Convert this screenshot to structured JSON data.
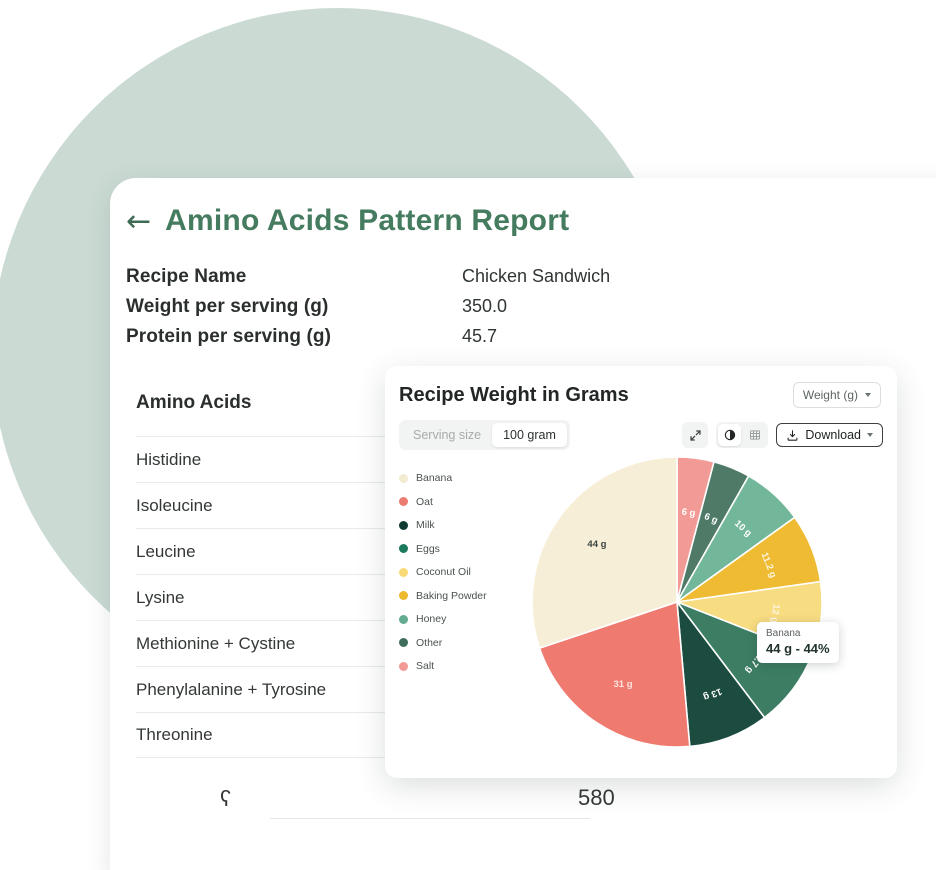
{
  "report": {
    "back_icon": "back-arrow-icon",
    "title": "Amino Acids Pattern Report",
    "meta": [
      {
        "label": "Recipe Name",
        "value": "Chicken Sandwich"
      },
      {
        "label": "Weight per serving (g)",
        "value": "350.0"
      },
      {
        "label": "Protein per serving (g)",
        "value": "45.7"
      }
    ],
    "table_header": "Amino Acids",
    "amino_acids": [
      "Histidine",
      "Isoleucine",
      "Leucine",
      "Lysine",
      "Methionine + Cystine",
      "Phenylalanine + Tyrosine",
      "Threonine"
    ],
    "footer_stub": "ʕ",
    "footer_number": "580"
  },
  "chart_card": {
    "title": "Recipe Weight in Grams",
    "unit_select": {
      "label": "Weight (g)",
      "icon": "chevron-down-icon"
    },
    "segmented": {
      "inactive_label": "Serving size",
      "active_label": "100 gram"
    },
    "tools": {
      "expand_icon": "expand-arrows-icon",
      "pie_icon": "pie-chart-icon",
      "table_icon": "table-grid-icon",
      "download_label": "Download",
      "download_icon": "download-icon",
      "download_caret_icon": "chevron-down-icon"
    }
  },
  "chart_data": {
    "type": "pie",
    "title": "Recipe Weight in Grams",
    "unit": "g",
    "total": 100,
    "legend_position": "left",
    "categories": [
      "Banana",
      "Oat",
      "Milk",
      "Eggs",
      "Coconut Oil",
      "Baking Powder",
      "Honey",
      "Other",
      "Salt"
    ],
    "legend_colors": [
      "#f2ead1",
      "#ec7b72",
      "#0f3b32",
      "#1b7a5c",
      "#f7d976",
      "#edb92e",
      "#63ab91",
      "#3f6d5b",
      "#f29a95"
    ],
    "slices": [
      {
        "name": "Salt",
        "value": 6,
        "label": "6 g",
        "color": "#f29a95",
        "label_color": "#ffffff"
      },
      {
        "name": "Other",
        "value": 6,
        "label": "6 g",
        "color": "#4e7a67",
        "label_color": "#ffffff"
      },
      {
        "name": "Honey",
        "value": 10,
        "label": "10 g",
        "color": "#73b79b",
        "label_color": "#ffffff"
      },
      {
        "name": "Baking Powder",
        "value": 11.2,
        "label": "11.2 g",
        "color": "#eebb33",
        "label_color": "#fbf3dc"
      },
      {
        "name": "Coconut Oil",
        "value": 12,
        "label": "12 g",
        "color": "#f8dc82",
        "label_color": "#fdf6e0"
      },
      {
        "name": "Eggs",
        "value": 12.7,
        "label": "12.7 g",
        "color": "#3c7d63",
        "label_color": "#ffffff"
      },
      {
        "name": "Milk",
        "value": 13,
        "label": "13 g",
        "color": "#1c4c3f",
        "label_color": "#ffffff"
      },
      {
        "name": "Oat",
        "value": 31,
        "label": "31 g",
        "color": "#ef7b70",
        "label_color": "#fde4df"
      },
      {
        "name": "Banana",
        "value": 44,
        "label": "44 g",
        "color": "#f6eed6",
        "label_color": "#3c4441"
      }
    ],
    "tooltip": {
      "name": "Banana",
      "value": "44 g - 44%"
    }
  },
  "colors": {
    "brand_green": "#457b5e",
    "deco_sage": "#cbdbd4"
  }
}
